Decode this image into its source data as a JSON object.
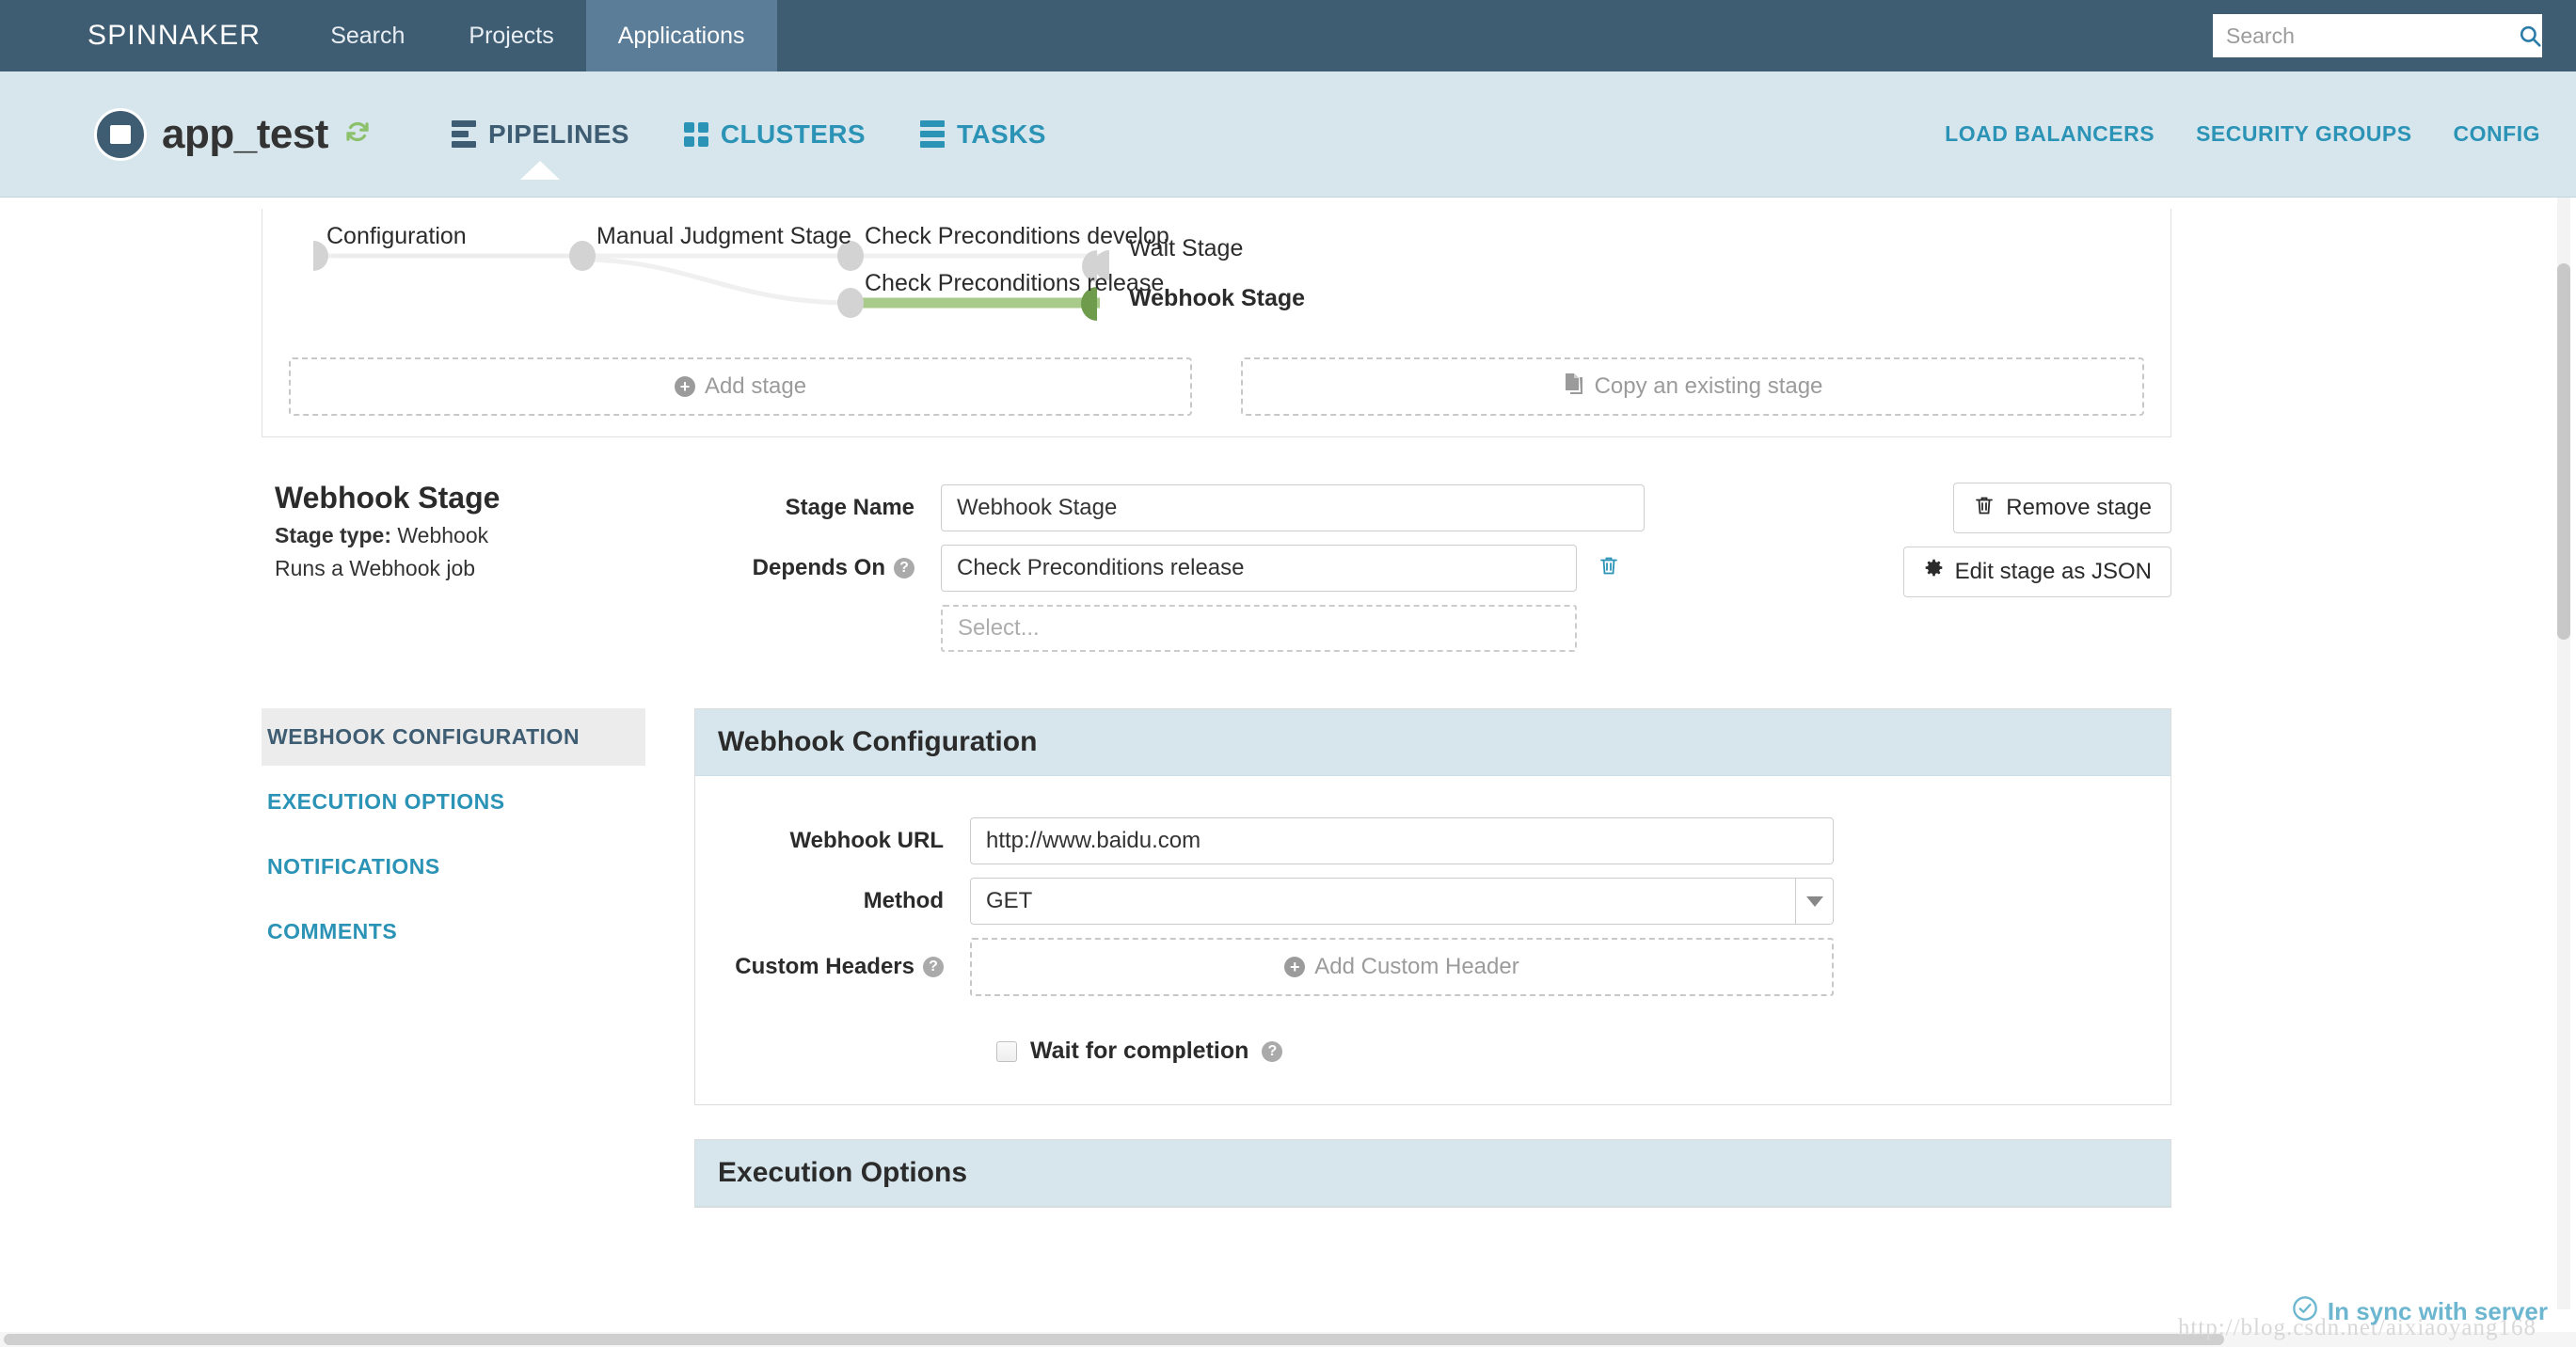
{
  "topnav": {
    "brand": "SPINNAKER",
    "items": [
      {
        "label": "Search",
        "active": false
      },
      {
        "label": "Projects",
        "active": false
      },
      {
        "label": "Applications",
        "active": true
      }
    ],
    "search_placeholder": "Search",
    "search_value": "",
    "search_icon": "search-icon"
  },
  "appheader": {
    "app_name": "app_test",
    "refresh_icon": "refresh-icon",
    "nav": [
      {
        "label": "PIPELINES",
        "icon": "pipelines-icon",
        "active": true
      },
      {
        "label": "CLUSTERS",
        "icon": "clusters-icon",
        "active": false
      },
      {
        "label": "TASKS",
        "icon": "tasks-icon",
        "active": false
      }
    ],
    "right_links": [
      "LOAD BALANCERS",
      "SECURITY GROUPS",
      "CONFIG"
    ]
  },
  "pipeline_graph": {
    "stages": [
      {
        "label": "Configuration",
        "selected": false
      },
      {
        "label": "Manual Judgment Stage",
        "selected": false
      },
      {
        "label": "Check Preconditions develop",
        "selected": false
      },
      {
        "label": "Check Preconditions release",
        "selected": false
      },
      {
        "label": "Wait Stage",
        "selected": false
      },
      {
        "label": "Webhook Stage",
        "selected": true
      }
    ],
    "add_stage_label": "Add stage",
    "add_stage_icon": "plus-circle-icon",
    "copy_stage_label": "Copy an existing stage",
    "copy_stage_icon": "copy-icon",
    "selected_color": "#a8ca8a"
  },
  "stage": {
    "title": "Webhook Stage",
    "type_label": "Stage type:",
    "type_value": "Webhook",
    "description": "Runs a Webhook job",
    "stage_name_label": "Stage Name",
    "stage_name_value": "Webhook Stage",
    "depends_on_label": "Depends On",
    "depends_on_help_icon": "help-icon",
    "depends_on_value": "Check Preconditions release",
    "depends_on_delete_icon": "trash-icon",
    "depends_on_select_placeholder": "Select...",
    "remove_button": "Remove stage",
    "remove_button_icon": "trash-icon",
    "edit_json_button": "Edit stage as JSON",
    "edit_json_icon": "gear-icon"
  },
  "config_tabs": [
    {
      "label": "WEBHOOK CONFIGURATION",
      "active": true
    },
    {
      "label": "EXECUTION OPTIONS",
      "active": false
    },
    {
      "label": "NOTIFICATIONS",
      "active": false
    },
    {
      "label": "COMMENTS",
      "active": false
    }
  ],
  "webhook_config": {
    "panel_title": "Webhook Configuration",
    "url_label": "Webhook URL",
    "url_value": "http://www.baidu.com",
    "method_label": "Method",
    "method_value": "GET",
    "method_caret_icon": "chevron-down-icon",
    "custom_headers_label": "Custom Headers",
    "custom_headers_help_icon": "help-icon",
    "add_custom_header_label": "Add Custom Header",
    "add_custom_header_icon": "plus-circle-icon",
    "wait_label": "Wait for completion",
    "wait_help_icon": "help-icon",
    "wait_checked": false
  },
  "execution_options": {
    "panel_title": "Execution Options"
  },
  "statusbar": {
    "text": "In sync with server",
    "icon": "check-circle-icon",
    "color": "#6cb6d0"
  },
  "watermark": "http://blog.csdn.net/aixiaoyang168"
}
